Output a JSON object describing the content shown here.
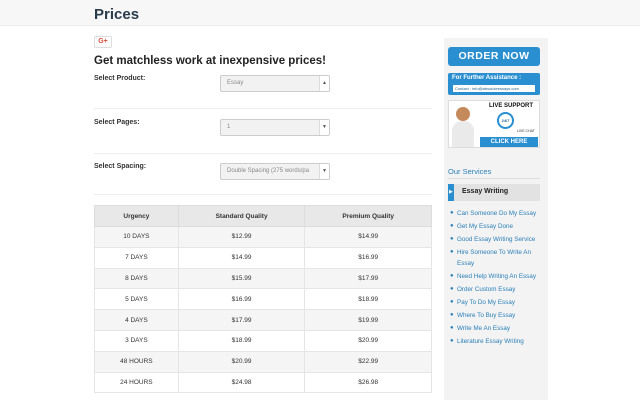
{
  "header": {
    "title": "Prices"
  },
  "share": {
    "gplus_label": "G+"
  },
  "form": {
    "headline": "Get matchless work at inexpensive prices!",
    "product_label": "Select Product:",
    "product_value": "Essay",
    "pages_label": "Select Pages:",
    "pages_value": "1",
    "spacing_label": "Select Spacing:",
    "spacing_value": "Double Spacing (275 words/pa"
  },
  "table": {
    "headers": [
      "Urgency",
      "Standard Quality",
      "Premium Quality"
    ],
    "rows": [
      [
        "10 DAYS",
        "$12.99",
        "$14.99"
      ],
      [
        "7 DAYS",
        "$14.99",
        "$16.99"
      ],
      [
        "8 DAYS",
        "$15.99",
        "$17.99"
      ],
      [
        "5 DAYS",
        "$16.99",
        "$18.99"
      ],
      [
        "4 DAYS",
        "$17.99",
        "$19.99"
      ],
      [
        "3 DAYS",
        "$18.99",
        "$20.99"
      ],
      [
        "48 HOURS",
        "$20.99",
        "$22.99"
      ],
      [
        "24 HOURS",
        "$24.98",
        "$26.98"
      ]
    ]
  },
  "sidebar": {
    "order_label": "ORDER NOW",
    "assist_title": "For Further Assistance :",
    "assist_contact": "Contact : info@absoluteessays.com",
    "support_title": "LIVE SUPPORT",
    "support_247": "24/7",
    "support_chat": "LIVE CHAT",
    "support_click": "CLICK HERE",
    "services_title": "Our Services",
    "active_service": "Essay Writing",
    "services": [
      "Can Someone Do My Essay",
      "Get My Essay Done",
      "Good Essay Writing Service",
      "Hire Someone To Write An Essay",
      "Need Help Writing An Essay",
      "Order Custom Essay",
      "Pay To Do My Essay",
      "Where To Buy Essay",
      "Write Me An Essay",
      "Literature Essay Writing"
    ]
  }
}
